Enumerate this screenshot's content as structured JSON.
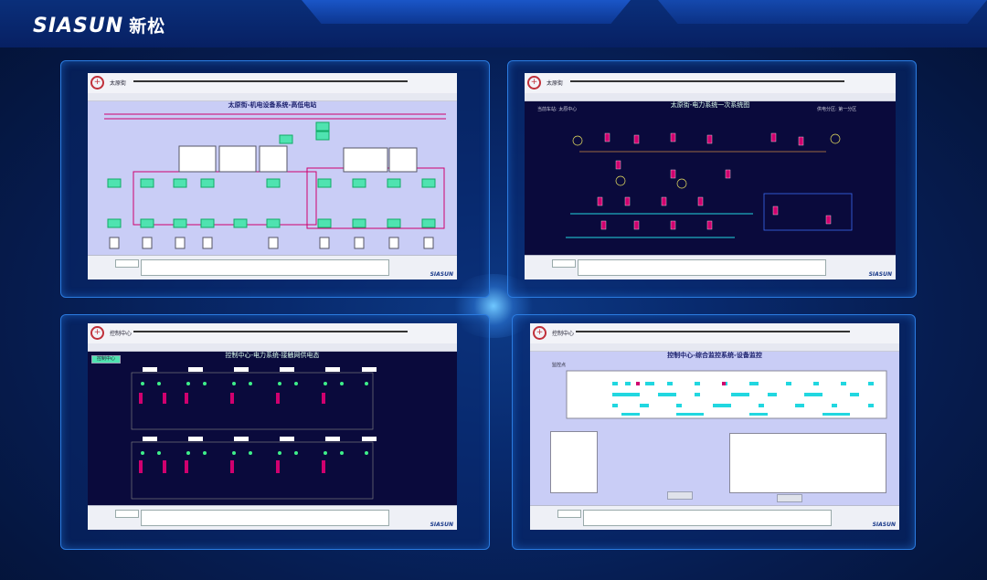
{
  "brand": {
    "logo_text": "SIASUN",
    "logo_cn": "新松"
  },
  "panels": {
    "p1": {
      "title": "太原街-机电设备系统-高低电站",
      "station": "太原街"
    },
    "p2": {
      "title": "太原街-电力系统一次系统图",
      "station": "太原街",
      "left_label": "当前车站: 太原中心",
      "right_label": "供电分区: 第一分区"
    },
    "p3": {
      "title": "控制中心-电力系统-接触网供电态",
      "station": "控制中心",
      "tag": "控制中心"
    },
    "p4": {
      "title": "控制中心-综合监控系统-设备监控",
      "station": "控制中心",
      "filter": "监控点"
    }
  },
  "footer": {
    "brand_small": "SIASUN"
  },
  "colors": {
    "bg": "#061c4f",
    "screen_blue": "#c9cdf6",
    "dark": "#0a0a3c",
    "accent_red": "#d0006f",
    "accent_cyan": "#21d7e0"
  }
}
